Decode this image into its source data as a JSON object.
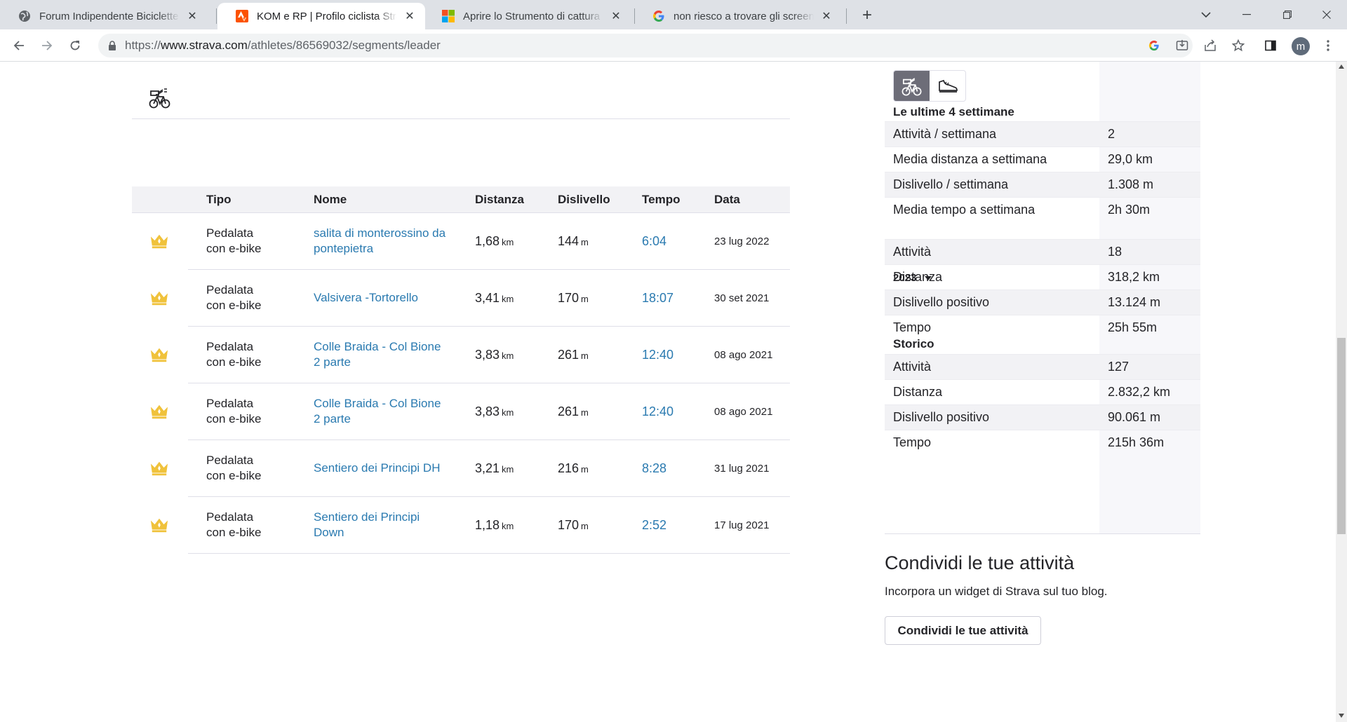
{
  "browser": {
    "tabs": [
      {
        "title": "Forum Indipendente Biciclette Elettriche",
        "icon": "forum-favicon",
        "active": false
      },
      {
        "title": "KOM e RP | Profilo ciclista Strava",
        "icon": "strava-favicon",
        "active": true
      },
      {
        "title": "Aprire lo Strumento di cattura e acquisire",
        "icon": "microsoft-favicon",
        "active": false
      },
      {
        "title": "non riesco a trovare gli screenshot",
        "icon": "google-favicon",
        "active": false
      }
    ],
    "url_prefix": "https://",
    "url_host": "www.strava.com",
    "url_path": "/athletes/86569032/segments/leader",
    "profile_initial": "m",
    "accent_color": "#fc5200"
  },
  "segments": {
    "headers": {
      "tipo": "Tipo",
      "nome": "Nome",
      "distanza": "Distanza",
      "dislivello": "Dislivello",
      "tempo": "Tempo",
      "data": "Data"
    },
    "rows": [
      {
        "tipo_1": "Pedalata",
        "tipo_2": "con e-bike",
        "nome": "salita di monterossino da pontepietra",
        "dist": "1,68",
        "dist_unit": "km",
        "disl": "144",
        "disl_unit": "m",
        "tempo": "6:04",
        "data": "23 lug 2022"
      },
      {
        "tipo_1": "Pedalata",
        "tipo_2": "con e-bike",
        "nome": "Valsivera -Tortorello",
        "dist": "3,41",
        "dist_unit": "km",
        "disl": "170",
        "disl_unit": "m",
        "tempo": "18:07",
        "data": "30 set 2021"
      },
      {
        "tipo_1": "Pedalata",
        "tipo_2": "con e-bike",
        "nome": "Colle Braida - Col Bione 2 parte",
        "dist": "3,83",
        "dist_unit": "km",
        "disl": "261",
        "disl_unit": "m",
        "tempo": "12:40",
        "data": "08 ago 2021"
      },
      {
        "tipo_1": "Pedalata",
        "tipo_2": "con e-bike",
        "nome": "Colle Braida - Col Bione 2 parte",
        "dist": "3,83",
        "dist_unit": "km",
        "disl": "261",
        "disl_unit": "m",
        "tempo": "12:40",
        "data": "08 ago 2021"
      },
      {
        "tipo_1": "Pedalata",
        "tipo_2": "con e-bike",
        "nome": "Sentiero dei Principi DH",
        "dist": "3,21",
        "dist_unit": "km",
        "disl": "216",
        "disl_unit": "m",
        "tempo": "8:28",
        "data": "31 lug 2021"
      },
      {
        "tipo_1": "Pedalata",
        "tipo_2": "con e-bike",
        "nome": "Sentiero dei Principi Down",
        "dist": "1,18",
        "dist_unit": "km",
        "disl": "170",
        "disl_unit": "m",
        "tempo": "2:52",
        "data": "17 lug 2021"
      }
    ],
    "crown_color": "#f0c23b",
    "link_color": "#2a7ab0"
  },
  "stats": {
    "last4_title": "Le ultime 4 settimane",
    "last4": [
      {
        "k": "Attività / settimana",
        "v": "2"
      },
      {
        "k": "Media distanza a settimana",
        "v": "29,0 km"
      },
      {
        "k": "Dislivello / settimana",
        "v": "1.308 m"
      },
      {
        "k": "Media tempo a settimana",
        "v": "2h 30m"
      }
    ],
    "year": "2023",
    "year_rows": [
      {
        "k": "Attività",
        "v": "18"
      },
      {
        "k": "Distanza",
        "v": "318,2 km"
      },
      {
        "k": "Dislivello positivo",
        "v": "13.124 m"
      },
      {
        "k": "Tempo",
        "v": "25h 55m"
      }
    ],
    "alltime_title": "Storico",
    "alltime_rows": [
      {
        "k": "Attività",
        "v": "127"
      },
      {
        "k": "Distanza",
        "v": "2.832,2 km"
      },
      {
        "k": "Dislivello positivo",
        "v": "90.061 m"
      },
      {
        "k": "Tempo",
        "v": "215h 36m"
      }
    ]
  },
  "share": {
    "title": "Condividi le tue attività",
    "subtitle": "Incorpora un widget di Strava sul tuo blog.",
    "button": "Condividi le tue attività"
  }
}
